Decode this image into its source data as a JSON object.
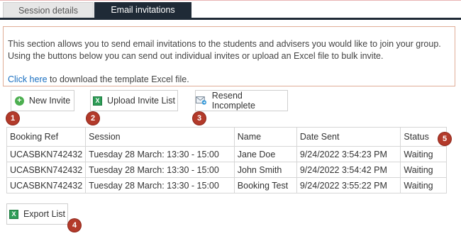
{
  "tabs": [
    {
      "label": "Session details",
      "active": false
    },
    {
      "label": "Email invitations",
      "active": true
    }
  ],
  "info": {
    "text": "This section allows you to send email invitations to the students and advisers you would like to join your group. Using the buttons below you can send out individual invites or upload an Excel file to bulk invite.",
    "link_text": "Click here",
    "link_suffix": " to download the template Excel file."
  },
  "buttons": {
    "new_invite": "New Invite",
    "upload_list": "Upload Invite List",
    "resend_incomplete": "Resend Incomplete",
    "export_list": "Export List"
  },
  "icons": {
    "new_invite": "plus-circle-icon",
    "upload_list": "excel-icon",
    "resend_incomplete": "resend-mail-icon",
    "export_list": "excel-icon"
  },
  "badges": [
    "1",
    "2",
    "3",
    "4",
    "5"
  ],
  "table": {
    "columns": [
      "Booking Ref",
      "Session",
      "Name",
      "Date Sent",
      "Status"
    ],
    "rows": [
      [
        "UCASBKN742432",
        "Tuesday 28 March: 13:30 - 15:00",
        "Jane Doe",
        "9/24/2022 3:54:23 PM",
        "Waiting"
      ],
      [
        "UCASBKN742432",
        "Tuesday 28 March: 13:30 - 15:00",
        "John Smith",
        "9/24/2022 3:54:42 PM",
        "Waiting"
      ],
      [
        "UCASBKN742432",
        "Tuesday 28 March: 13:30 - 15:00",
        "Booking Test",
        "9/24/2022 3:55:22 PM",
        "Waiting"
      ]
    ]
  },
  "colors": {
    "active_tab": "#1f2a36",
    "badge": "#b33a2a",
    "link": "#1a6fc0",
    "info_border": "#e0ad97"
  }
}
